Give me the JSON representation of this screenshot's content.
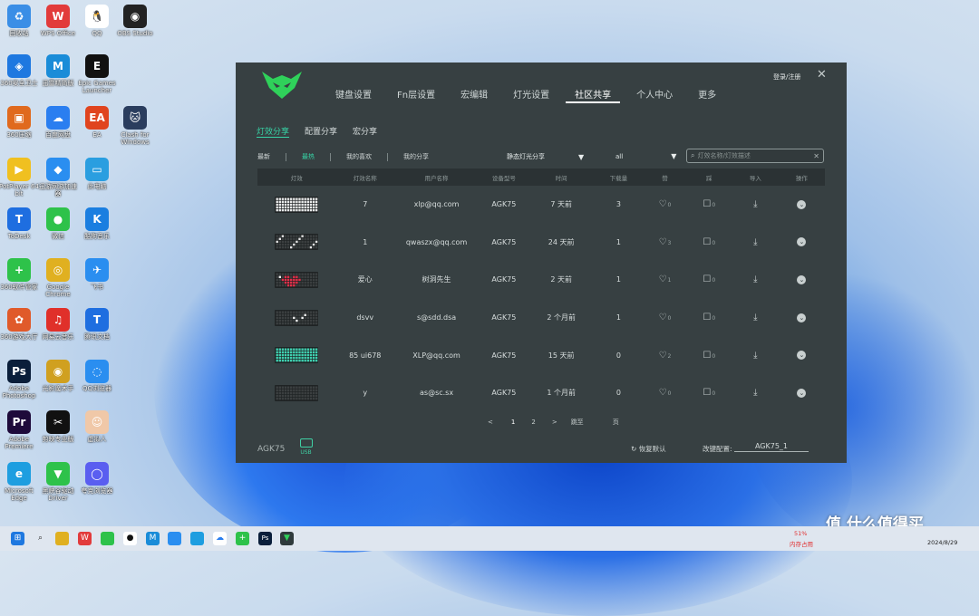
{
  "desktop": [
    {
      "label": "回收站",
      "color": "#3a8ee6",
      "glyph": "♻"
    },
    {
      "label": "WPS Office",
      "color": "#e23b3b",
      "glyph": "W"
    },
    {
      "label": "QQ",
      "color": "#ffffff",
      "glyph": "🐧"
    },
    {
      "label": "OBS Studio",
      "color": "#222222",
      "glyph": "◉"
    },
    {
      "label": "360安全卫士",
      "color": "#1e78e0",
      "glyph": "◈"
    },
    {
      "label": "迅雷精简版",
      "color": "#1a8cd8",
      "glyph": "M"
    },
    {
      "label": "Epic Games Launcher",
      "color": "#111111",
      "glyph": "E"
    },
    {
      "label": "360压缩",
      "color": "#e06a1e",
      "glyph": "▣"
    },
    {
      "label": "百度网盘",
      "color": "#2a7ef0",
      "glyph": "☁"
    },
    {
      "label": "EA",
      "color": "#e0441e",
      "glyph": "EA"
    },
    {
      "label": "Clash for Windows",
      "color": "#2a3d5e",
      "glyph": "🐱"
    },
    {
      "label": "PotPlayer 64 bit",
      "color": "#f0c020",
      "glyph": "▶"
    },
    {
      "label": "迅游网游加速器",
      "color": "#2a8ef0",
      "glyph": "◆"
    },
    {
      "label": "此电脑",
      "color": "#2a9ee0",
      "glyph": "▭"
    },
    {
      "label": "ToDesk",
      "color": "#1e6ee0",
      "glyph": "T"
    },
    {
      "label": "微信",
      "color": "#2ec24a",
      "glyph": "●"
    },
    {
      "label": "酷狗音乐",
      "color": "#1a7ee0",
      "glyph": "K"
    },
    {
      "label": "360软件管家",
      "color": "#2ec24a",
      "glyph": "+"
    },
    {
      "label": "Google Chrome",
      "color": "#e0b020",
      "glyph": "◎"
    },
    {
      "label": "飞书",
      "color": "#2a8ef0",
      "glyph": "✈"
    },
    {
      "label": "360游戏大厅",
      "color": "#e05a2a",
      "glyph": "✿"
    },
    {
      "label": "网易云音乐",
      "color": "#e0302a",
      "glyph": "♫"
    },
    {
      "label": "腾讯文档",
      "color": "#1e6ee0",
      "glyph": "T"
    },
    {
      "label": "Adobe Photoshop",
      "color": "#0a1e3a",
      "glyph": "Ps"
    },
    {
      "label": "光影魔术手",
      "color": "#d0a020",
      "glyph": "◉"
    },
    {
      "label": "QQ浏览器",
      "color": "#2a8ef0",
      "glyph": "◌"
    },
    {
      "label": "Adobe Premiere",
      "color": "#1e0a3a",
      "glyph": "Pr"
    },
    {
      "label": "剪映专业版",
      "color": "#111111",
      "glyph": "✂"
    },
    {
      "label": "虚拟人",
      "color": "#f0c8a8",
      "glyph": "☺"
    },
    {
      "label": "Microsoft Edge",
      "color": "#1e9ee0",
      "glyph": "e"
    },
    {
      "label": "黑峡谷驱动 Driver",
      "color": "#2ec24a",
      "glyph": "▼"
    },
    {
      "label": "夸克浏览器",
      "color": "#5a5ef0",
      "glyph": "◯"
    }
  ],
  "app": {
    "login": "登录/注册",
    "nav": [
      "键盘设置",
      "Fn层设置",
      "宏编辑",
      "灯光设置",
      "社区共享",
      "个人中心",
      "更多"
    ],
    "active_nav": 4,
    "subtabs": [
      "灯效分享",
      "配置分享",
      "宏分享"
    ],
    "filters": [
      "最新",
      "最热",
      "我的喜欢",
      "我的分享"
    ],
    "active_filter": 1,
    "dropdown1": "静态灯光分享",
    "dropdown2": "all",
    "search_placeholder": "灯效名称/灯效描述",
    "columns": [
      "灯效",
      "灯效名称",
      "用户名称",
      "设备型号",
      "时间",
      "下载量",
      "赞",
      "踩",
      "导入",
      "操作"
    ],
    "rows": [
      {
        "name": "7",
        "user": "xlp@qq.com",
        "device": "AGK75",
        "time": "7 天前",
        "downloads": "3",
        "likes": "0",
        "dislikes": "0",
        "pattern": "white"
      },
      {
        "name": "1",
        "user": "qwaszx@qq.com",
        "device": "AGK75",
        "time": "24 天前",
        "downloads": "1",
        "likes": "3",
        "dislikes": "0",
        "pattern": "sparse"
      },
      {
        "name": "爱心",
        "user": "树洞先生",
        "device": "AGK75",
        "time": "2 天前",
        "downloads": "1",
        "likes": "1",
        "dislikes": "0",
        "pattern": "heart"
      },
      {
        "name": "dsvv",
        "user": "s@sdd.dsa",
        "device": "AGK75",
        "time": "2 个月前",
        "downloads": "1",
        "likes": "0",
        "dislikes": "0",
        "pattern": "dots"
      },
      {
        "name": "85 ui678",
        "user": "XLP@qq.com",
        "device": "AGK75",
        "time": "15 天前",
        "downloads": "0",
        "likes": "2",
        "dislikes": "0",
        "pattern": "teal"
      },
      {
        "name": "y",
        "user": "as@sc.sx",
        "device": "AGK75",
        "time": "1 个月前",
        "downloads": "0",
        "likes": "0",
        "dislikes": "0",
        "pattern": "plain"
      }
    ],
    "pager": {
      "prev": "<",
      "pages": [
        "1",
        "2"
      ],
      "next": ">",
      "goto": "跳至",
      "page_unit": "页"
    },
    "device_label": "AGK75",
    "usb_label": "USB",
    "restore": "恢复默认",
    "change_label": "改键配置:",
    "change_value": "AGK75_1"
  },
  "taskbar": {
    "battery": "51%",
    "battery_sub": "内存占用",
    "date": "2024/8/29"
  },
  "watermark": "值 什么值得买"
}
